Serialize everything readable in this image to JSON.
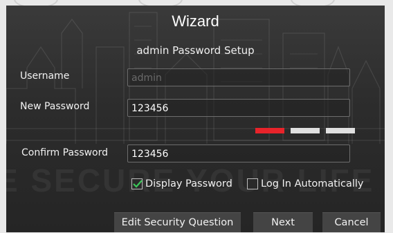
{
  "wizard": {
    "title": "Wizard",
    "subtitle": "admin Password Setup"
  },
  "form": {
    "username_label": "Username",
    "username_value": "admin",
    "new_password_label": "New Password",
    "new_password_value": "123456",
    "confirm_password_label": "Confirm Password",
    "confirm_password_value": "123456",
    "password_strength": {
      "level": 1,
      "max": 3,
      "active_color": "#e8232a",
      "inactive_color": "#e0e0e0"
    }
  },
  "options": {
    "display_password_label": "Display Password",
    "display_password_checked": true,
    "log_in_auto_label": "Log In Automatically",
    "log_in_auto_checked": false
  },
  "buttons": {
    "edit_security_label": "Edit Security Question",
    "next_label": "Next",
    "cancel_label": "Cancel"
  },
  "background": {
    "watermark_text": "E SECURE YOUR LIFE"
  },
  "colors": {
    "dialog_bg": "#2e2e2e",
    "check_green": "#3cc85a"
  }
}
